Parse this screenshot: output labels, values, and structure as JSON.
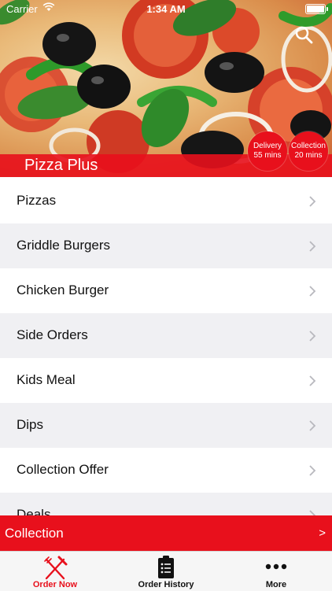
{
  "status_bar": {
    "carrier": "Carrier",
    "time": "1:34 AM"
  },
  "hero": {
    "restaurant_name": "Pizza Plus",
    "search_icon": "search-icon",
    "delivery": {
      "label": "Delivery",
      "time": "55 mins"
    },
    "collection": {
      "label": "Collection",
      "time": "20 mins"
    }
  },
  "menu": {
    "items": [
      {
        "label": "Pizzas"
      },
      {
        "label": "Griddle Burgers"
      },
      {
        "label": "Chicken Burger"
      },
      {
        "label": "Side Orders"
      },
      {
        "label": "Kids Meal"
      },
      {
        "label": "Dips"
      },
      {
        "label": "Collection Offer"
      },
      {
        "label": "Deals"
      }
    ]
  },
  "order_bar": {
    "label": "Collection",
    "arrow": ">"
  },
  "tabs": [
    {
      "label": "Order Now",
      "icon": "fork-knife-icon",
      "active": true
    },
    {
      "label": "Order History",
      "icon": "clipboard-icon",
      "active": false
    },
    {
      "label": "More",
      "icon": "more-dots-icon",
      "active": false
    }
  ],
  "colors": {
    "brand_red": "#e8101c",
    "tab_bg": "#f6f6f6",
    "alt_row": "#f0f0f3"
  }
}
